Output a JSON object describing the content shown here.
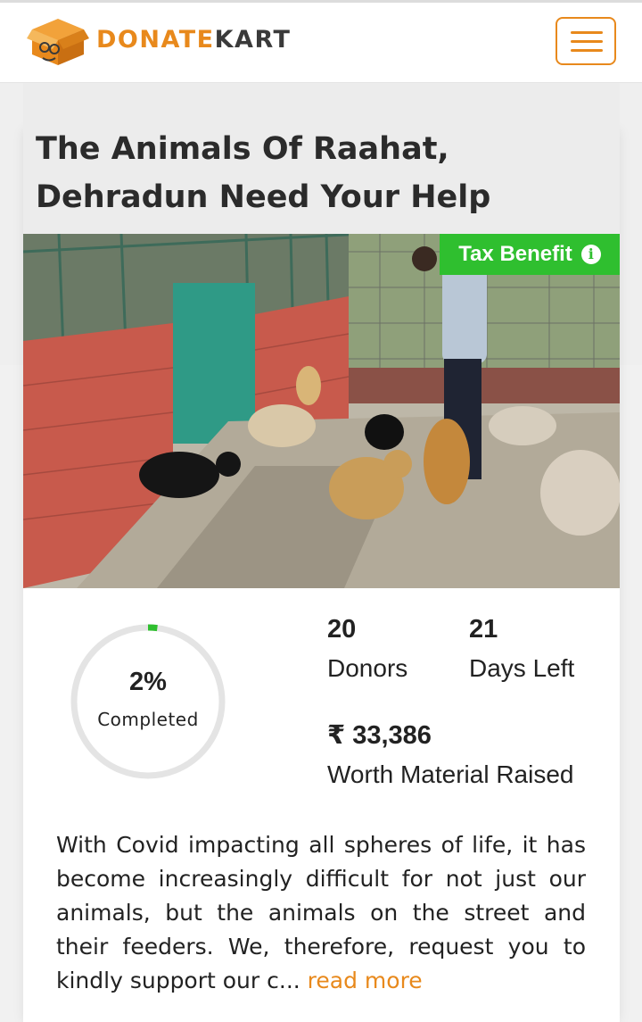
{
  "brand": {
    "name_part1": "DONATE",
    "name_part2": "KART",
    "accent_color": "#e8891c"
  },
  "header": {
    "menu_icon": "hamburger-menu-icon"
  },
  "campaign": {
    "title": "The Animals Of Raahat, Dehradun Need Your Help",
    "image_description": "photo of dogs in an animal shelter yard with a caretaker",
    "tax_badge": {
      "label": "Tax Benefit",
      "icon": "info-icon",
      "color": "#2fbf2f"
    },
    "progress": {
      "percent_text": "2%",
      "label": "Completed",
      "value": 0.02,
      "color": "#2fbf2f"
    },
    "stats": {
      "donors": {
        "value": "20",
        "label": "Donors"
      },
      "days_left": {
        "value": "21",
        "label": "Days Left"
      },
      "raised": {
        "value": "₹ 33,386",
        "label": "Worth Material Raised"
      }
    },
    "description": "With Covid impacting all spheres of life, it has become increasingly difficult for not just our animals, but the animals on the street and their feeders. We, therefore, request you to kindly support our c...",
    "read_more": "read more"
  }
}
